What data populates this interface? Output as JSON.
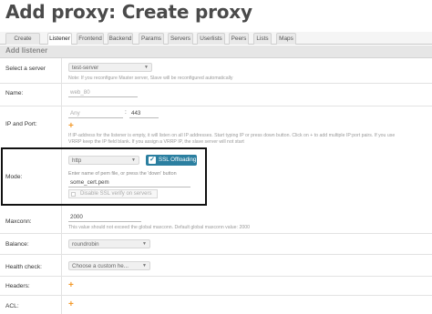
{
  "page": {
    "title": "Add proxy: Create proxy",
    "tabs": [
      {
        "label": "Create proxy"
      },
      {
        "label": "Listener"
      },
      {
        "label": "Frontend"
      },
      {
        "label": "Backend"
      },
      {
        "label": "Params"
      },
      {
        "label": "Servers"
      },
      {
        "label": "Userlists"
      },
      {
        "label": "Peers"
      },
      {
        "label": "Lists"
      },
      {
        "label": "Maps"
      }
    ],
    "active_tab": "Listener",
    "section_title": "Add listener"
  },
  "form": {
    "server": {
      "label": "Select a server",
      "value": "test-server",
      "note": "Note: If you reconfigure Master server, Slave will be reconfigured automatically"
    },
    "name": {
      "label": "Name:",
      "placeholder": "web_80"
    },
    "ip_port": {
      "label": "IP and Port:",
      "ip_placeholder": "Any",
      "separator": ":",
      "port_value": "443",
      "add_icon": "plus-icon",
      "note_line1": "If IP-address for the listener is empty, it will listen on all IP addresses. Start typing IP or press down button. Click on + to add multiple IP:port pairs. If you use",
      "note_line2": "VRRP keep the IP field blank. If you assign a VRRP IP, the slave server will not start"
    },
    "mode": {
      "label": "Mode:",
      "value": "http",
      "ssl_label": "SSL Offloading",
      "ssl_checked": true,
      "pem_hint": "Enter name of pem file, or press the 'down' button",
      "pem_value": "some_cert.pem",
      "disable_ssl_label": "Disable SSL verify on servers"
    },
    "maxconn": {
      "label": "Maxconn:",
      "value": "2000",
      "note": "This value should not exceed the global maxconn. Default global maxconn value: 2000"
    },
    "balance": {
      "label": "Balance:",
      "value": "roundrobin"
    },
    "health_check": {
      "label": "Health check:",
      "value": "Choose a custom he..."
    },
    "headers": {
      "label": "Headers:",
      "add_icon": "plus-icon"
    },
    "acl": {
      "label": "ACL:",
      "add_icon": "plus-icon"
    }
  },
  "colors": {
    "accent_orange": "#f39a2b",
    "ssl_toggle": "#2b7fa0"
  }
}
